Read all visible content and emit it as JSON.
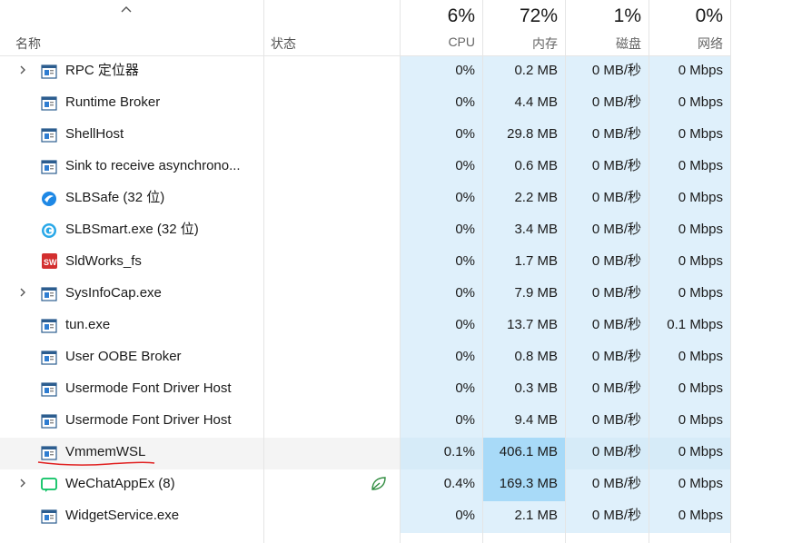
{
  "header": {
    "name_label": "名称",
    "status_label": "状态",
    "cpu": {
      "pct": "6%",
      "label": "CPU"
    },
    "memory": {
      "pct": "72%",
      "label": "内存"
    },
    "disk": {
      "pct": "1%",
      "label": "磁盘"
    },
    "network": {
      "pct": "0%",
      "label": "网络"
    }
  },
  "processes": [
    {
      "name": "RPC 定位器",
      "icon": "app-window-icon",
      "expandable": true,
      "cpu": "0%",
      "memory": "0.2 MB",
      "disk": "0 MB/秒",
      "network": "0 Mbps"
    },
    {
      "name": "Runtime Broker",
      "icon": "app-window-icon",
      "expandable": false,
      "cpu": "0%",
      "memory": "4.4 MB",
      "disk": "0 MB/秒",
      "network": "0 Mbps"
    },
    {
      "name": "ShellHost",
      "icon": "app-window-icon",
      "expandable": false,
      "cpu": "0%",
      "memory": "29.8 MB",
      "disk": "0 MB/秒",
      "network": "0 Mbps"
    },
    {
      "name": "Sink to receive asynchrono...",
      "icon": "app-window-icon",
      "expandable": false,
      "cpu": "0%",
      "memory": "0.6 MB",
      "disk": "0 MB/秒",
      "network": "0 Mbps"
    },
    {
      "name": "SLBSafe (32 位)",
      "icon": "slbsafe-icon",
      "expandable": false,
      "cpu": "0%",
      "memory": "2.2 MB",
      "disk": "0 MB/秒",
      "network": "0 Mbps"
    },
    {
      "name": "SLBSmart.exe (32 位)",
      "icon": "slbsmart-icon",
      "expandable": false,
      "cpu": "0%",
      "memory": "3.4 MB",
      "disk": "0 MB/秒",
      "network": "0 Mbps"
    },
    {
      "name": "SldWorks_fs",
      "icon": "solidworks-icon",
      "expandable": false,
      "cpu": "0%",
      "memory": "1.7 MB",
      "disk": "0 MB/秒",
      "network": "0 Mbps"
    },
    {
      "name": "SysInfoCap.exe",
      "icon": "app-window-icon",
      "expandable": true,
      "cpu": "0%",
      "memory": "7.9 MB",
      "disk": "0 MB/秒",
      "network": "0 Mbps"
    },
    {
      "name": "tun.exe",
      "icon": "app-window-icon",
      "expandable": false,
      "cpu": "0%",
      "memory": "13.7 MB",
      "disk": "0 MB/秒",
      "network": "0.1 Mbps"
    },
    {
      "name": "User OOBE Broker",
      "icon": "app-window-icon",
      "expandable": false,
      "cpu": "0%",
      "memory": "0.8 MB",
      "disk": "0 MB/秒",
      "network": "0 Mbps"
    },
    {
      "name": "Usermode Font Driver Host",
      "icon": "app-window-icon",
      "expandable": false,
      "cpu": "0%",
      "memory": "0.3 MB",
      "disk": "0 MB/秒",
      "network": "0 Mbps"
    },
    {
      "name": "Usermode Font Driver Host",
      "icon": "app-window-icon",
      "expandable": false,
      "cpu": "0%",
      "memory": "9.4 MB",
      "disk": "0 MB/秒",
      "network": "0 Mbps"
    },
    {
      "name": "VmmemWSL",
      "icon": "app-window-icon",
      "expandable": false,
      "cpu": "0.1%",
      "memory": "406.1 MB",
      "disk": "0 MB/秒",
      "network": "0 Mbps",
      "selected": true,
      "memory_hot": true
    },
    {
      "name": "WeChatAppEx (8)",
      "icon": "wechat-icon",
      "expandable": true,
      "cpu": "0.4%",
      "memory": "169.3 MB",
      "disk": "0 MB/秒",
      "network": "0 Mbps",
      "status_icon": "efficiency-leaf-icon",
      "memory_hot": true
    },
    {
      "name": "WidgetService.exe",
      "icon": "app-window-icon",
      "expandable": false,
      "cpu": "0%",
      "memory": "2.1 MB",
      "disk": "0 MB/秒",
      "network": "0 Mbps"
    }
  ],
  "colors": {
    "cell_heat": "#dff0fb",
    "cell_hot": "#a8daf8",
    "annotation_underline": "#e02020"
  }
}
